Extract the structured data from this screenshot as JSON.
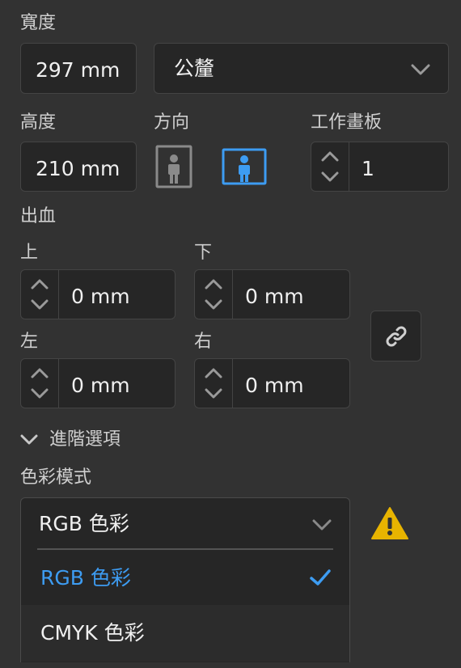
{
  "width": {
    "label": "寬度",
    "value": "297 mm",
    "preset": "公釐"
  },
  "height": {
    "label": "高度",
    "value": "210 mm"
  },
  "orientation": {
    "label": "方向",
    "options": [
      "portrait",
      "landscape"
    ],
    "selected": "landscape",
    "accent": "#3d9cf2"
  },
  "artboards": {
    "label": "工作畫板",
    "value": "1"
  },
  "bleed": {
    "label": "出血",
    "top": {
      "label": "上",
      "value": "0 mm"
    },
    "bottom": {
      "label": "下",
      "value": "0 mm"
    },
    "left": {
      "label": "左",
      "value": "0 mm"
    },
    "right": {
      "label": "右",
      "value": "0 mm"
    },
    "link_icon": "link-icon"
  },
  "advanced": {
    "label": "進階選項",
    "expanded": true
  },
  "color_mode": {
    "label": "色彩模式",
    "selected": "RGB 色彩",
    "options": [
      {
        "label": "RGB 色彩",
        "checked": true
      },
      {
        "label": "CMYK 色彩",
        "checked": false
      }
    ],
    "warning_icon": "warning-icon",
    "warning_color": "#e8b400"
  },
  "colors": {
    "background": "#323232",
    "field": "#262626",
    "accent": "#3d9cf2",
    "text": "#f0f0f0"
  }
}
